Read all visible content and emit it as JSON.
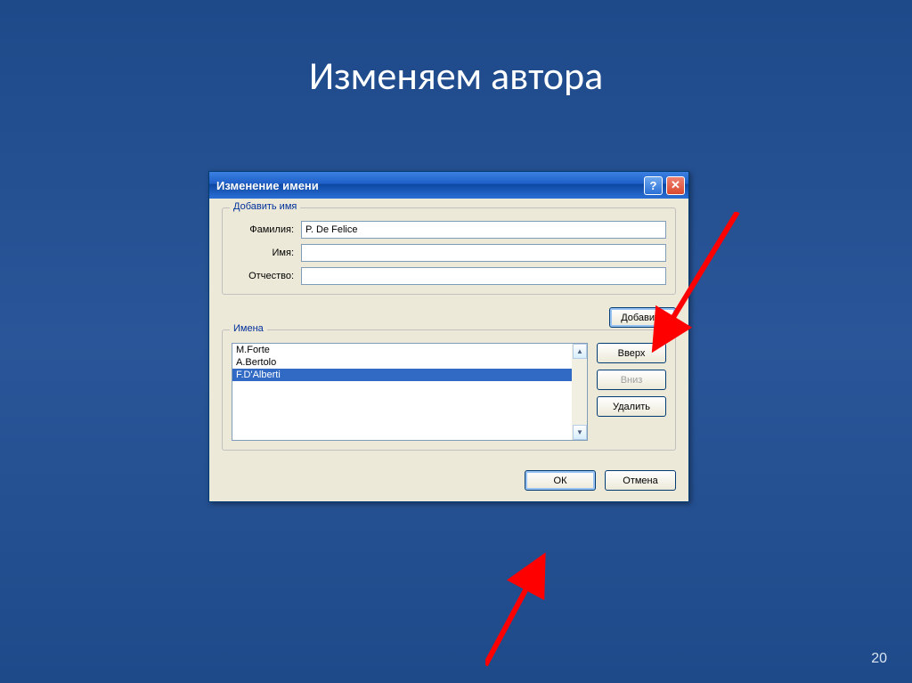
{
  "slide": {
    "title": "Изменяем автора",
    "page_number": "20"
  },
  "dialog": {
    "title": "Изменение имени",
    "groups": {
      "add_name_legend": "Добавить имя",
      "names_legend": "Имена"
    },
    "labels": {
      "last_name": "Фамилия:",
      "first_name": "Имя:",
      "middle_name": "Отчество:"
    },
    "values": {
      "last_name": "P. De Felice",
      "first_name": "",
      "middle_name": ""
    },
    "buttons": {
      "add": "Добавить",
      "up": "Вверх",
      "down": "Вниз",
      "delete": "Удалить",
      "ok": "ОК",
      "cancel": "Отмена"
    },
    "names_list": {
      "items": [
        {
          "text": "M.Forte",
          "selected": false
        },
        {
          "text": "A.Bertolo",
          "selected": false
        },
        {
          "text": "F.D'Alberti",
          "selected": true
        }
      ]
    }
  }
}
